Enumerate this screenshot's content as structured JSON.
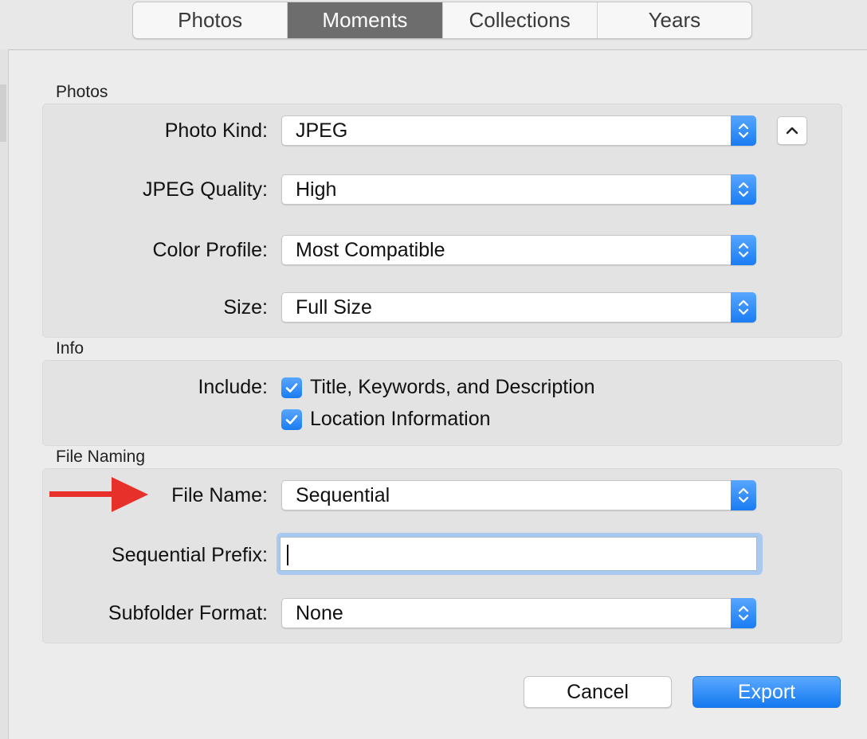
{
  "tabs": [
    {
      "label": "Photos",
      "active": false
    },
    {
      "label": "Moments",
      "active": true
    },
    {
      "label": "Collections",
      "active": false
    },
    {
      "label": "Years",
      "active": false
    }
  ],
  "photos_section": {
    "title": "Photos",
    "photo_kind": {
      "label": "Photo Kind:",
      "value": "JPEG"
    },
    "jpeg_quality": {
      "label": "JPEG Quality:",
      "value": "High"
    },
    "color_profile": {
      "label": "Color Profile:",
      "value": "Most Compatible"
    },
    "size": {
      "label": "Size:",
      "value": "Full Size"
    }
  },
  "info_section": {
    "title": "Info",
    "include_label": "Include:",
    "options": [
      {
        "label": "Title, Keywords, and Description",
        "checked": true
      },
      {
        "label": "Location Information",
        "checked": true
      }
    ]
  },
  "file_naming_section": {
    "title": "File Naming",
    "file_name": {
      "label": "File Name:",
      "value": "Sequential"
    },
    "sequential_prefix": {
      "label": "Sequential Prefix:",
      "value": ""
    },
    "subfolder_format": {
      "label": "Subfolder Format:",
      "value": "None"
    }
  },
  "buttons": {
    "cancel": "Cancel",
    "export": "Export"
  },
  "colors": {
    "accent": "#1a7cf2",
    "annotation_arrow": "#e8302a"
  },
  "icons": {
    "stepper": "up-down-chevron-icon",
    "disclosure": "chevron-up-icon",
    "check": "checkmark-icon",
    "annotation": "red-arrow-icon"
  }
}
